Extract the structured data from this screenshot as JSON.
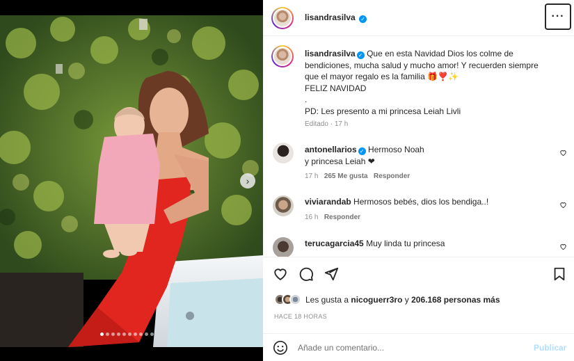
{
  "post": {
    "username": "lisandrasilva",
    "verified_icon": "verified-badge-icon",
    "more_label": "···"
  },
  "caption": {
    "username": "lisandrasilva",
    "text_line1": "Que en esta Navidad Dios los colme de",
    "text_line2": "bendiciones, mucha salud y mucho amor! Y recuerden siempre",
    "text_line3": "que el mayor regalo es la familia 🎁❣️✨",
    "text_line4": "FELIZ NAVIDAD",
    "text_line5": ".",
    "text_line6": "PD: Les presento a mi princesa Leiah Livli",
    "edited": "Editado",
    "time": "17 h"
  },
  "comments": [
    {
      "username": "antonellarios",
      "verified": true,
      "text_a": "Hermoso Noah",
      "text_b": "y princesa Leiah ❤",
      "time": "17 h",
      "likes": "265 Me gusta",
      "reply": "Responder"
    },
    {
      "username": "viviarandab",
      "verified": false,
      "text_a": "Hermosos bebés, dios los bendiga..!",
      "time": "16 h",
      "reply": "Responder"
    },
    {
      "username": "terucagarcia45",
      "verified": false,
      "text_a": "Muy linda tu princesa"
    }
  ],
  "likes": {
    "prefix": "Les gusta a",
    "user": "nicoguerr3ro",
    "connector": "y",
    "count": "206.168 personas más"
  },
  "posted_ago": "HACE 18 HORAS",
  "comment_box": {
    "placeholder": "Añade un comentario...",
    "publish": "Publicar"
  },
  "carousel": {
    "total": 10,
    "active": 1,
    "next": "›"
  },
  "colors": {
    "accent": "#0095f6",
    "publish_disabled": "#b2dffc",
    "dress": "#e0261f"
  }
}
